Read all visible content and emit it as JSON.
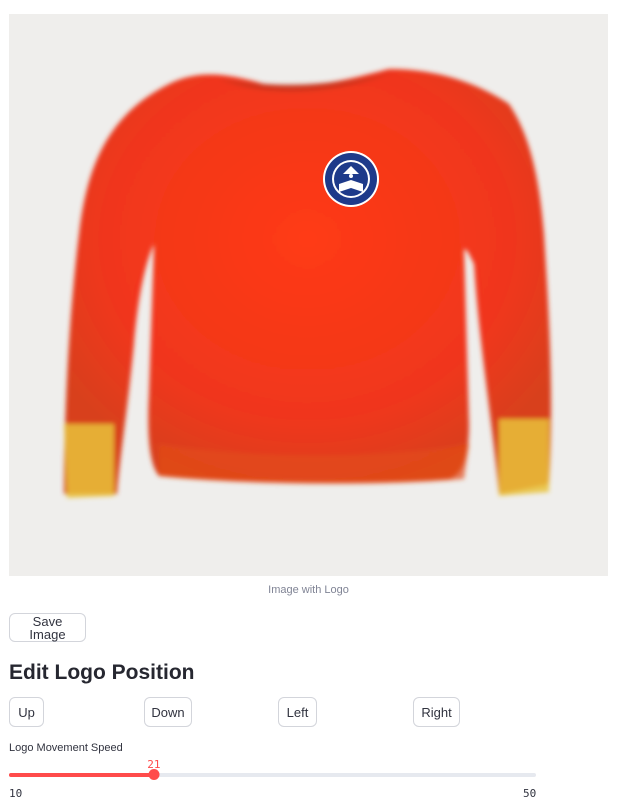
{
  "image": {
    "caption": "Image with Logo",
    "background_color": "#efeeec",
    "shirt_color": "#f43a1a",
    "logo_color": "#1e3a8a"
  },
  "actions": {
    "save_label": "Save Image"
  },
  "edit_section": {
    "title": "Edit Logo Position",
    "buttons": {
      "up": "Up",
      "down": "Down",
      "left": "Left",
      "right": "Right"
    }
  },
  "speed_slider": {
    "label": "Logo Movement Speed",
    "value": 21,
    "min": 10,
    "max": 50,
    "accent": "#ff4b4b"
  }
}
